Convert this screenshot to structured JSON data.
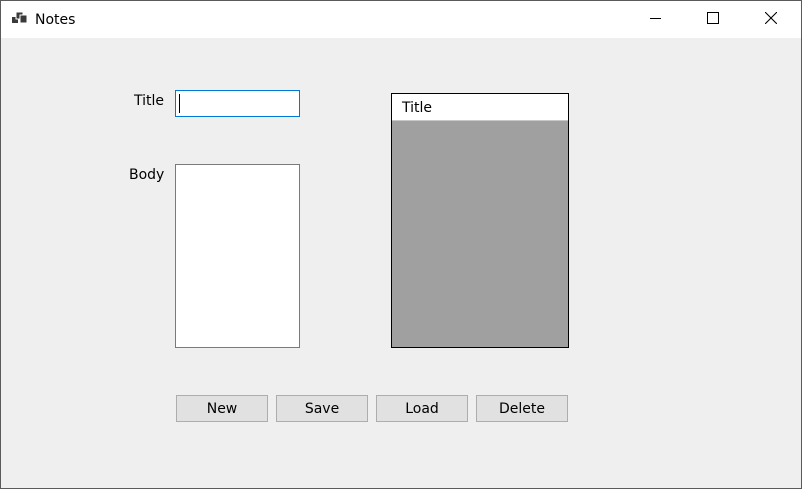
{
  "window": {
    "title": "Notes",
    "app_icon": "app-window-icon",
    "caption_icons": [
      "minimize-icon",
      "maximize-icon",
      "close-icon"
    ]
  },
  "form": {
    "title_label": "Title",
    "title_value": "",
    "body_label": "Body",
    "body_value": ""
  },
  "notes_grid": {
    "columns": [
      "Title"
    ],
    "rows": [],
    "background_color": "#a0a0a0"
  },
  "buttons": {
    "new_label": "New",
    "save_label": "Save",
    "load_label": "Load",
    "delete_label": "Delete"
  },
  "colors": {
    "window_bg": "#efefef",
    "titlebar_bg": "#ffffff",
    "focus_border": "#0078d7",
    "button_bg": "#e1e1e1"
  }
}
